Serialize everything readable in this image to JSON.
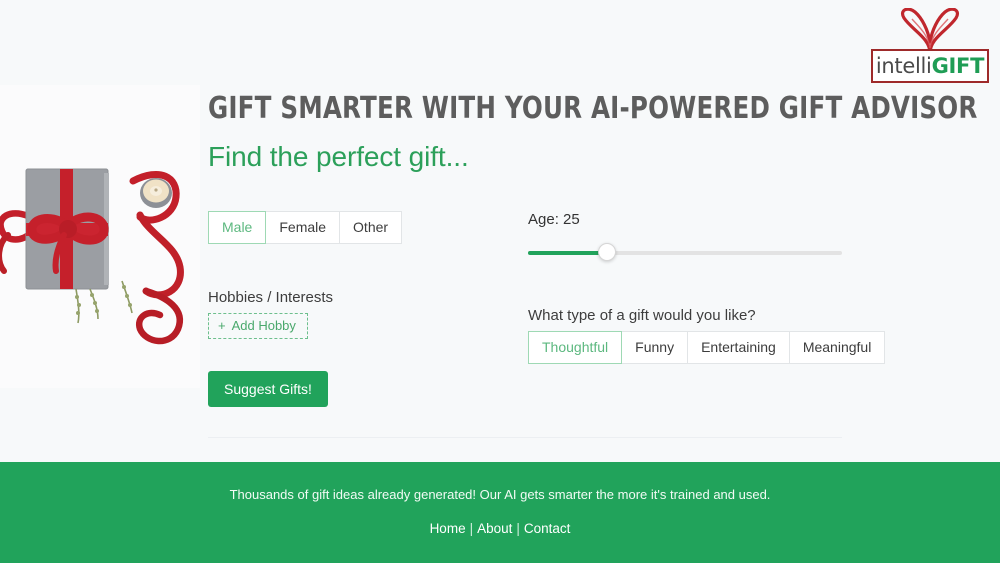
{
  "logo": {
    "name": "intelliGIFT",
    "text_part1": "intelli",
    "text_part2": "GIFT",
    "heart_icon": "heart-ribbon-icon",
    "border_color": "#9e2a2a",
    "accent_color": "#1f9d55"
  },
  "hero": {
    "image_alt": "gray-gift-box-with-red-ribbon-and-candle",
    "headline": "Gift Smarter With Your AI-Powered Gift Advisor",
    "subheadline": "Find the perfect gift..."
  },
  "form": {
    "gender": {
      "options": [
        {
          "label": "Male",
          "selected": true
        },
        {
          "label": "Female",
          "selected": false
        },
        {
          "label": "Other",
          "selected": false
        }
      ]
    },
    "hobbies": {
      "label": "Hobbies / Interests",
      "add_button_label": "Add Hobby",
      "add_button_icon": "plus-icon",
      "plus_glyph": "+"
    },
    "age": {
      "label": "Age: 25",
      "value": 25,
      "min": 0,
      "max": 100,
      "fill_percent": 25
    },
    "gift_type": {
      "question": "What type of a gift would you like?",
      "options": [
        {
          "label": "Thoughtful",
          "selected": true
        },
        {
          "label": "Funny",
          "selected": false
        },
        {
          "label": "Entertaining",
          "selected": false
        },
        {
          "label": "Meaningful",
          "selected": false
        }
      ]
    },
    "submit_label": "Suggest Gifts!"
  },
  "footer": {
    "tagline": "Thousands of gift ideas already generated! Our AI gets smarter the more it's trained and used.",
    "links": [
      {
        "label": "Home"
      },
      {
        "label": "About"
      },
      {
        "label": "Contact"
      }
    ],
    "separator": "|",
    "background_color": "#21a35b"
  },
  "theme": {
    "page_background": "#f7f9fa",
    "brand_green": "#21a35b",
    "heading_gray": "#5d5d5d"
  }
}
